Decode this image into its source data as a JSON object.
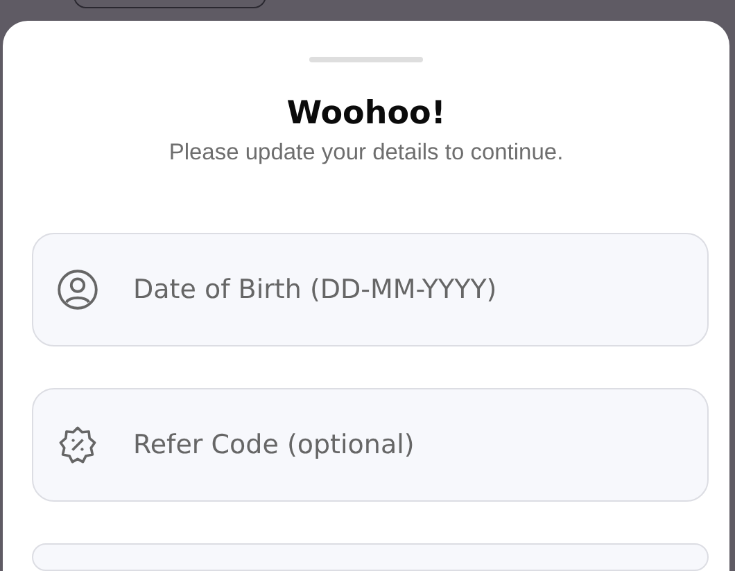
{
  "sheet": {
    "title": "Woohoo!",
    "subtitle": "Please update your details to continue.",
    "fields": [
      {
        "kind": "person",
        "placeholder": "Date of Birth (DD-MM-YYYY)"
      },
      {
        "kind": "badge",
        "placeholder": "Refer Code (optional)"
      }
    ]
  }
}
